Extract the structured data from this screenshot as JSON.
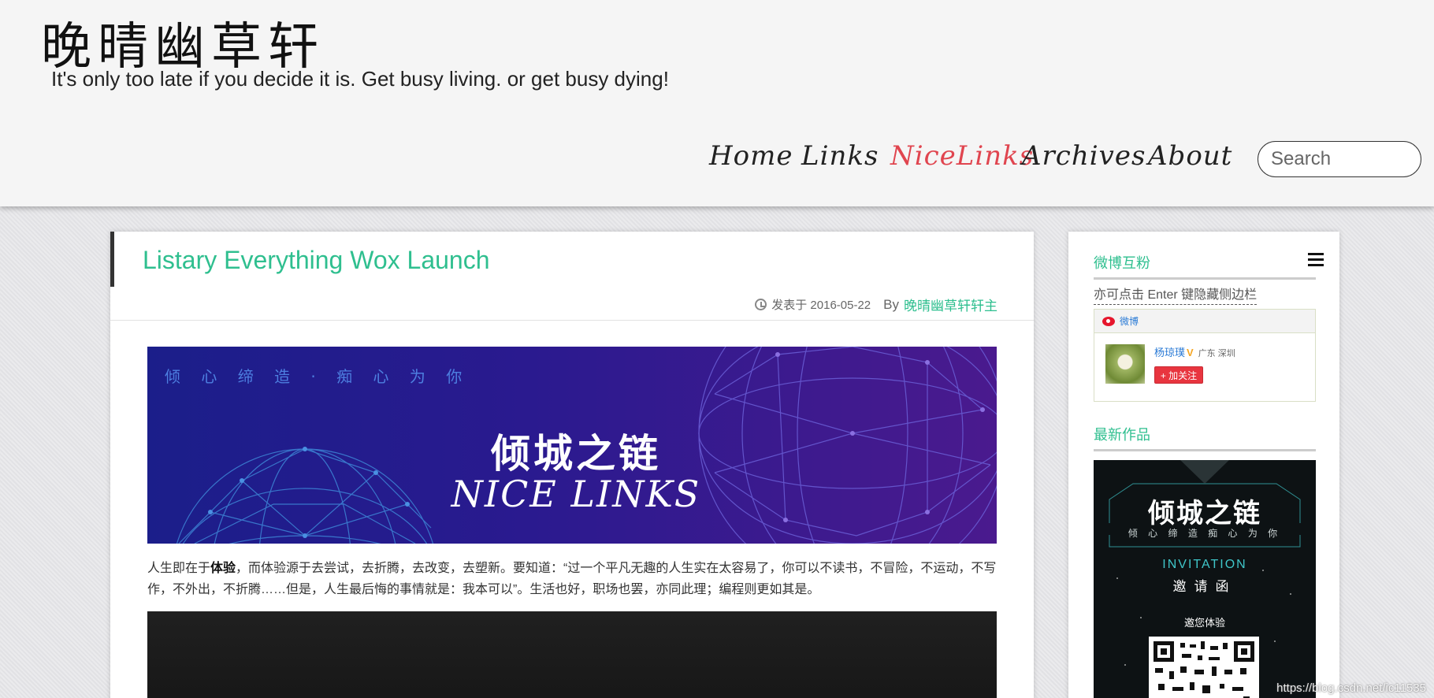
{
  "header": {
    "site_title": "晚晴幽草轩",
    "tagline": "It's only too late if you decide it is. Get busy living. or get busy dying!",
    "nav": [
      {
        "label": "Home",
        "active": false
      },
      {
        "label": "Links",
        "active": false
      },
      {
        "label": "NiceLinks",
        "active": true
      },
      {
        "label": "Archives",
        "active": false
      },
      {
        "label": "About",
        "active": false
      }
    ],
    "search_placeholder": "Search",
    "active_color": "#e0454f"
  },
  "post": {
    "title": "Listary Everything Wox Launch",
    "date": "发表于 2016-05-22",
    "by_label": "By",
    "author": "晚晴幽草轩轩主",
    "title_color": "#2fbf8f",
    "banner": {
      "slogan": "倾 心 缔 造 · 痴 心 为 你",
      "title_cn": "倾城之链",
      "title_en": "NICE LINKS"
    },
    "paragraph_before": "人生即在于",
    "paragraph_bold": "体验",
    "paragraph_after": "，而体验源于去尝试，去折腾，去改变，去塑新。要知道：“过一个平凡无趣的人生实在太容易了，你可以不读书，不冒险，不运动，不写作，不外出，不折腾……但是，人生最后悔的事情就是：我本可以”。生活也好，职场也罢，亦同此理；编程则更如其是。"
  },
  "sidebar": {
    "weibo_title": "微博互粉",
    "hint": "亦可点击 Enter 键隐藏侧边栏",
    "weibo_widget": {
      "label": "微博",
      "user": "杨琼璞",
      "vip": "V",
      "location": "广东 深圳",
      "follow_label": "+ 加关注"
    },
    "works_title": "最新作品",
    "invite": {
      "title": "倾城之链",
      "slogan": "倾 心 缔 造   痴 心 为 你",
      "en": "INVITATION",
      "cn": "邀请函",
      "experience": "邀您体验"
    }
  },
  "watermark": "https://blog.csdn.net/ic11535"
}
